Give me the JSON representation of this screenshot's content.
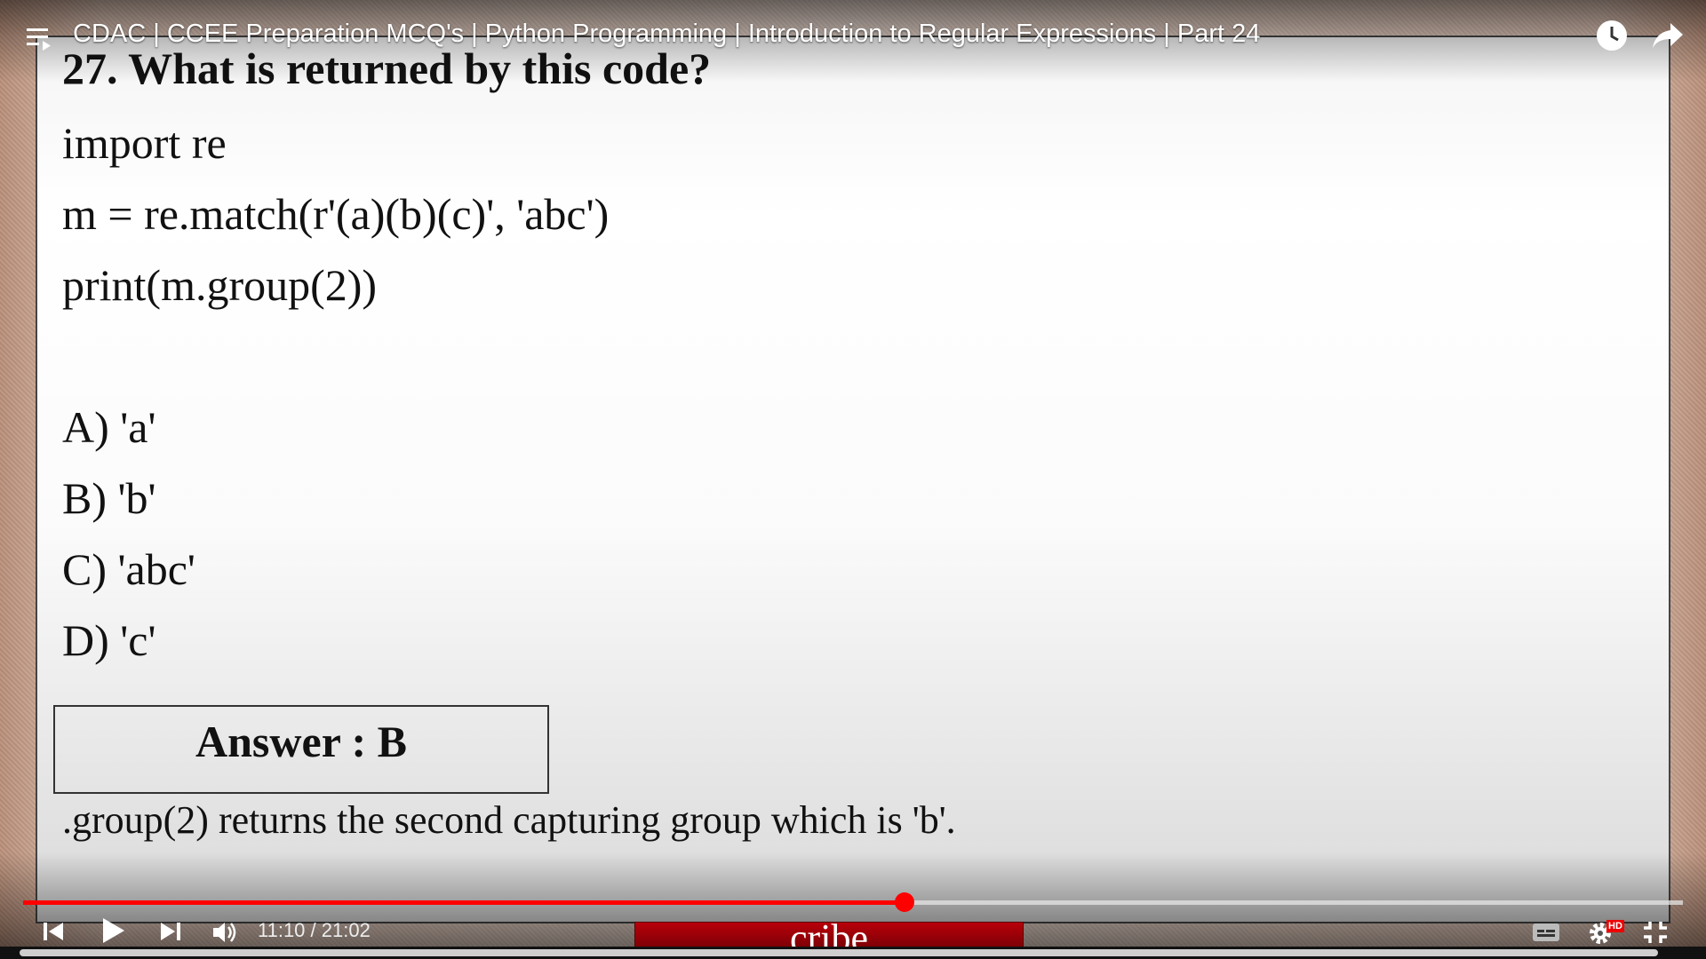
{
  "player": {
    "title": "CDAC | CCEE Preparation MCQ's | Python Programming | Introduction to Regular Expressions | Part 24",
    "time_display": "11:10 / 21:02",
    "progress_fraction": 0.531,
    "subscribe_text": "cribe",
    "hd_badge": "HD",
    "accent_color": "#ff0000"
  },
  "slide": {
    "question": "27. What is returned by this code?",
    "code": [
      "import re",
      "m = re.match(r'(a)(b)(c)', 'abc')",
      "print(m.group(2))"
    ],
    "options": [
      "A) 'a'",
      "B) 'b'",
      "C) 'abc'",
      "D) 'c'"
    ],
    "answer": "Answer : B",
    "explanation": ".group(2) returns the second capturing group which is 'b'."
  }
}
